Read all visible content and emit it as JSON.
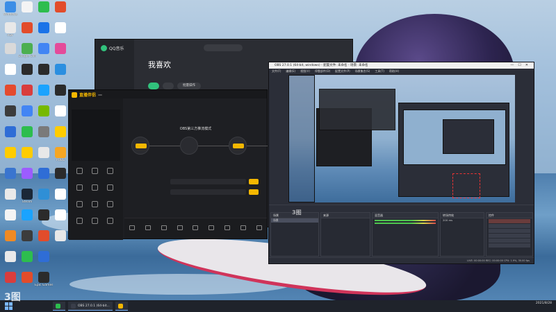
{
  "desktop_icons": [
    {
      "label": "Windows",
      "color": "#3c8ee6"
    },
    {
      "label": "PDF",
      "color": "#e8e8e8"
    },
    {
      "label": "",
      "color": "#d9d9d9"
    },
    {
      "label": "",
      "color": "#ffffff"
    },
    {
      "label": "",
      "color": "#e44b2f"
    },
    {
      "label": "",
      "color": "#3c3c3c"
    },
    {
      "label": "",
      "color": "#2f6dd6"
    },
    {
      "label": "",
      "color": "#ffcc00"
    },
    {
      "label": "",
      "color": "#3a75cf"
    },
    {
      "label": "",
      "color": "#e9e9e9"
    },
    {
      "label": "",
      "color": "#f4f4f4"
    },
    {
      "label": "",
      "color": "#f08a24"
    },
    {
      "label": "",
      "color": "#e9e9e9"
    },
    {
      "label": "",
      "color": "#d93d3d"
    },
    {
      "label": "",
      "color": "#f4f4f4"
    },
    {
      "label": "",
      "color": "#e24c2b"
    },
    {
      "label": "Google Chrome",
      "color": "#4caf50"
    },
    {
      "label": "",
      "color": "#2b2b2b"
    },
    {
      "label": "",
      "color": "#d93d3d"
    },
    {
      "label": "",
      "color": "#4285f4"
    },
    {
      "label": "",
      "color": "#2dbd4e"
    },
    {
      "label": "",
      "color": "#ffcc00"
    },
    {
      "label": "",
      "color": "#9c5cff"
    },
    {
      "label": "Steam",
      "color": "#1b2838"
    },
    {
      "label": "",
      "color": "#1aa3ff"
    },
    {
      "label": "",
      "color": "#3c3c3c"
    },
    {
      "label": "",
      "color": "#2dbd4e"
    },
    {
      "label": "",
      "color": "#e24c2b"
    },
    {
      "label": "",
      "color": "#2dbd4e"
    },
    {
      "label": "",
      "color": "#1a73e8"
    },
    {
      "label": "",
      "color": "#4285f4"
    },
    {
      "label": "",
      "color": "#2b2b2b"
    },
    {
      "label": "",
      "color": "#1aa3ff"
    },
    {
      "label": "",
      "color": "#76b900"
    },
    {
      "label": "",
      "color": "#7a7a7a"
    },
    {
      "label": "",
      "color": "#e8e8e8"
    },
    {
      "label": "",
      "color": "#2f6dd6"
    },
    {
      "label": "",
      "color": "#2f8fd6"
    },
    {
      "label": "",
      "color": "#2b2b2b"
    },
    {
      "label": "",
      "color": "#e24c2b"
    },
    {
      "label": "",
      "color": "#2f6dd6"
    },
    {
      "label": "Epic Games Launcher",
      "color": "#2b2b2b"
    },
    {
      "label": "",
      "color": "#e24c2b"
    },
    {
      "label": "",
      "color": "#ffffff"
    },
    {
      "label": "",
      "color": "#e44b9a"
    },
    {
      "label": "",
      "color": "#2b8fe0"
    },
    {
      "label": "",
      "color": "#2b2b2b"
    },
    {
      "label": "",
      "color": "#ffffff"
    },
    {
      "label": "",
      "color": "#ffcc00"
    },
    {
      "label": "PUBG",
      "color": "#f5a623"
    },
    {
      "label": "",
      "color": "#2b2b2b"
    },
    {
      "label": "",
      "color": "#ffffff"
    },
    {
      "label": "",
      "color": "#ffffff"
    },
    {
      "label": "",
      "color": "#e8e8e8"
    }
  ],
  "qq": {
    "app_name": "QQ音乐",
    "page_title": "我喜欢",
    "nav": [
      "",
      "",
      "",
      ""
    ],
    "tabs": [
      "",
      "",
      "",
      "",
      ""
    ],
    "buttons": {
      "play": "",
      "download": "",
      "batch": "批量操作"
    }
  },
  "live": {
    "brand": "直播伴侣",
    "version": "",
    "head": "",
    "subhead": "",
    "mode_title": "OBS第三方推流模式",
    "steps": [
      {
        "pill": "",
        "label": ""
      },
      {
        "pill": "",
        "label": ""
      },
      {
        "pill": "",
        "label": ""
      }
    ],
    "rows": [
      {
        "key": "",
        "value": "",
        "button": ""
      },
      {
        "key": "",
        "value": "",
        "button": ""
      }
    ],
    "note": "",
    "grid": [
      "",
      "",
      "",
      "",
      "",
      "",
      "",
      "",
      "",
      "",
      "",
      ""
    ],
    "bottom_tools": [
      "",
      "",
      "",
      "",
      "",
      "",
      "",
      "",
      ""
    ],
    "status": ""
  },
  "obs": {
    "title": "OBS 27.0.1 (64-bit, windows) - 配置文件: 未命名 - 场景: 未命名",
    "menu": [
      "文件(F)",
      "编辑(E)",
      "视图(V)",
      "停靠部件(D)",
      "配置文件(P)",
      "场景集合(S)",
      "工具(T)",
      "帮助(H)"
    ],
    "source_bar": "",
    "docks": {
      "scenes": {
        "title": "场景",
        "items": [
          "场景"
        ]
      },
      "sources": {
        "title": "来源",
        "items": [
          "",
          "",
          "",
          "",
          "",
          "",
          "",
          "",
          "",
          ""
        ]
      },
      "mixer": {
        "title": "混音器",
        "items": [
          "",
          "",
          ""
        ]
      },
      "transitions": {
        "title": "转场特效",
        "items": [
          "",
          "200 ms"
        ]
      },
      "controls": {
        "title": "控件",
        "items": [
          "",
          "",
          "",
          "",
          "",
          ""
        ]
      }
    },
    "status": "LIVE: 00:00:00   REC: 00:00:00   CPU: 1.9%, 30.00 fps"
  },
  "taskbar": {
    "items": [
      {
        "label": "",
        "color": "#2dbd4e"
      },
      {
        "label": "OBS 27.0.1 (64-bit...",
        "color": "#3a3e4a"
      },
      {
        "label": "",
        "color": "#f5b700"
      }
    ],
    "time": "",
    "date": "2021/8/28"
  },
  "watermark": "3图"
}
